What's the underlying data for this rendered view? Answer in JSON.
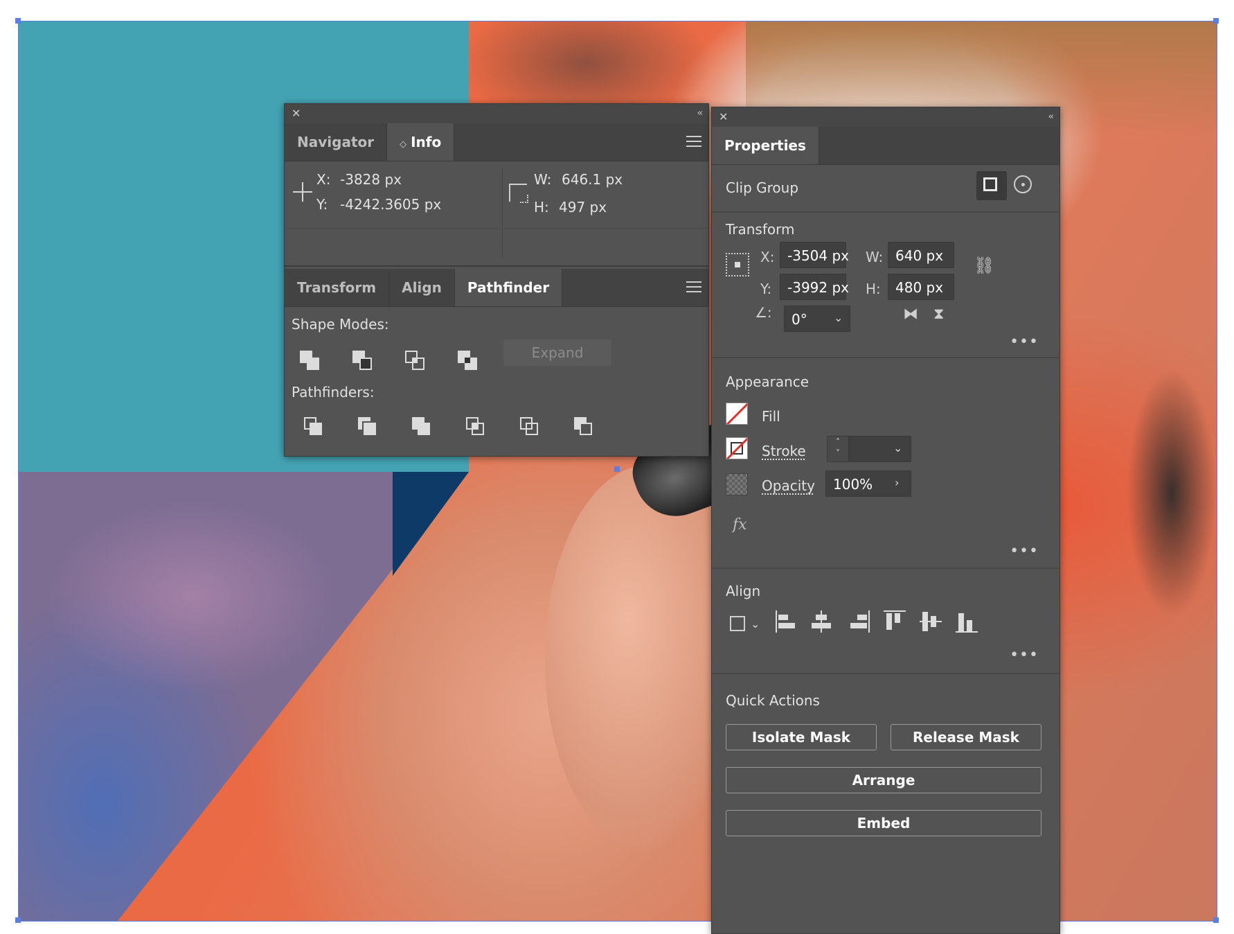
{
  "nav_panel": {
    "tabs": [
      "Navigator",
      "Info"
    ],
    "info": {
      "x_label": "X:",
      "x_value": "-3828 px",
      "y_label": "Y:",
      "y_value": "-4242.3605 px",
      "w_label": "W:",
      "w_value": "646.1 px",
      "h_label": "H:",
      "h_value": "497 px"
    },
    "tabs2": [
      "Transform",
      "Align",
      "Pathfinder"
    ],
    "shape_modes_label": "Shape Modes:",
    "expand_label": "Expand",
    "pathfinders_label": "Pathfinders:"
  },
  "props_panel": {
    "title": "Properties",
    "object_type": "Clip Group",
    "transform": {
      "title": "Transform",
      "x_label": "X:",
      "x_value": "-3504 px",
      "y_label": "Y:",
      "y_value": "-3992 px",
      "w_label": "W:",
      "w_value": "640 px",
      "h_label": "H:",
      "h_value": "480 px",
      "rotate_value": "0°"
    },
    "appearance": {
      "title": "Appearance",
      "fill_label": "Fill",
      "stroke_label": "Stroke",
      "opacity_label": "Opacity",
      "opacity_value": "100%",
      "fx_label": "fx"
    },
    "align": {
      "title": "Align"
    },
    "quick_actions": {
      "title": "Quick Actions",
      "isolate_mask": "Isolate Mask",
      "release_mask": "Release Mask",
      "arrange": "Arrange",
      "embed": "Embed"
    }
  },
  "colors": {
    "panel_bg": "#535353",
    "tab_bg": "#434343",
    "teal_shape": "#44a3b3",
    "selection": "#5b7ee0",
    "none_red": "#e0322a"
  }
}
